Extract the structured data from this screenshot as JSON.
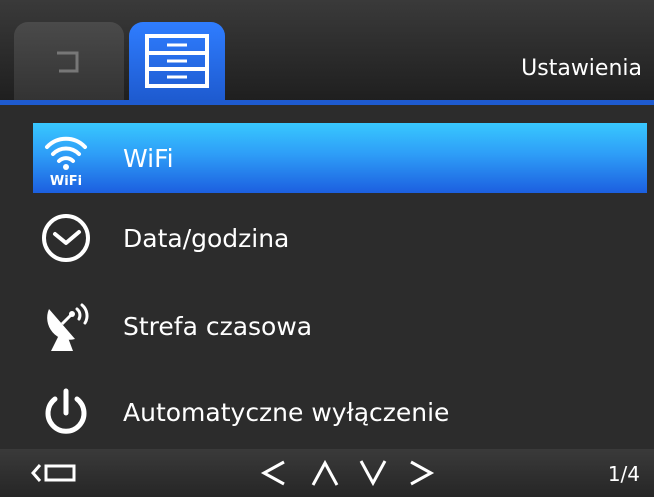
{
  "header": {
    "title": "Ustawienia",
    "tabs": [
      {
        "name": "back",
        "icon": "return-icon"
      },
      {
        "name": "settings",
        "icon": "settings-drawers-icon",
        "active": true
      }
    ]
  },
  "menu": {
    "items": [
      {
        "label": "WiFi",
        "icon": "wifi-icon",
        "icon_text": "WiFi",
        "selected": true
      },
      {
        "label": "Data/godzina",
        "icon": "clock-icon",
        "selected": false
      },
      {
        "label": "Strefa czasowa",
        "icon": "satellite-dish-icon",
        "selected": false
      },
      {
        "label": "Automatyczne wyłączenie",
        "icon": "power-icon",
        "selected": false
      }
    ]
  },
  "footer": {
    "page_indicator": "1/4"
  },
  "colors": {
    "accent": "#1e5bd0",
    "selected_top": "#38c8ff",
    "selected_bottom": "#1c5fe0",
    "background": "#2c2c2c"
  }
}
